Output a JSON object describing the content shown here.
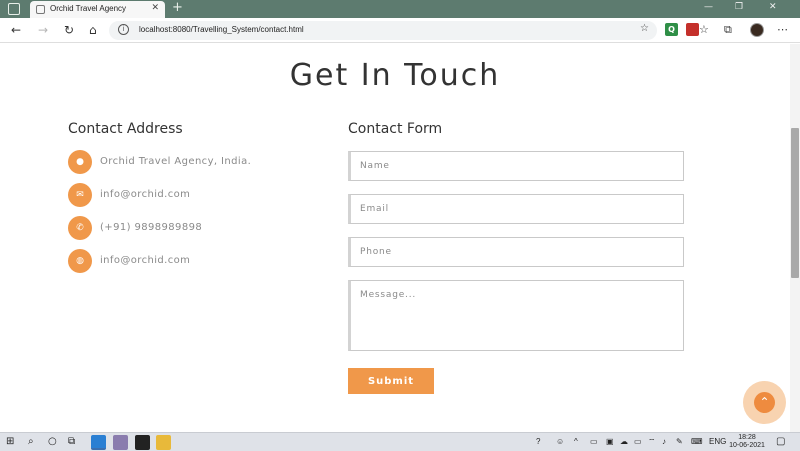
{
  "browser": {
    "tab_title": "Orchid Travel Agency",
    "tab_close": "✕",
    "new_tab": "+",
    "url": "localhost:8080/Travelling_System/contact.html",
    "minimize": "—",
    "maximize": "❐",
    "close": "✕"
  },
  "page": {
    "heading": "Get In Touch",
    "contact_address": {
      "title": "Contact Address",
      "items": [
        {
          "icon": "map-pin-icon",
          "text": "Orchid Travel Agency, India."
        },
        {
          "icon": "envelope-icon",
          "text": "info@orchid.com"
        },
        {
          "icon": "phone-icon",
          "text": "(+91) 9898989898"
        },
        {
          "icon": "globe-icon",
          "text": "info@orchid.com"
        }
      ]
    },
    "contact_form": {
      "title": "Contact Form",
      "name_placeholder": "Name",
      "email_placeholder": "Email",
      "phone_placeholder": "Phone",
      "message_placeholder": "Message...",
      "submit_label": "Submit"
    }
  },
  "taskbar": {
    "lang": "ENG",
    "time": "18:28",
    "date": "10-06-2021"
  },
  "colors": {
    "accent": "#f0984a",
    "tab_bar": "#5d7b6f",
    "heading": "#333333"
  }
}
